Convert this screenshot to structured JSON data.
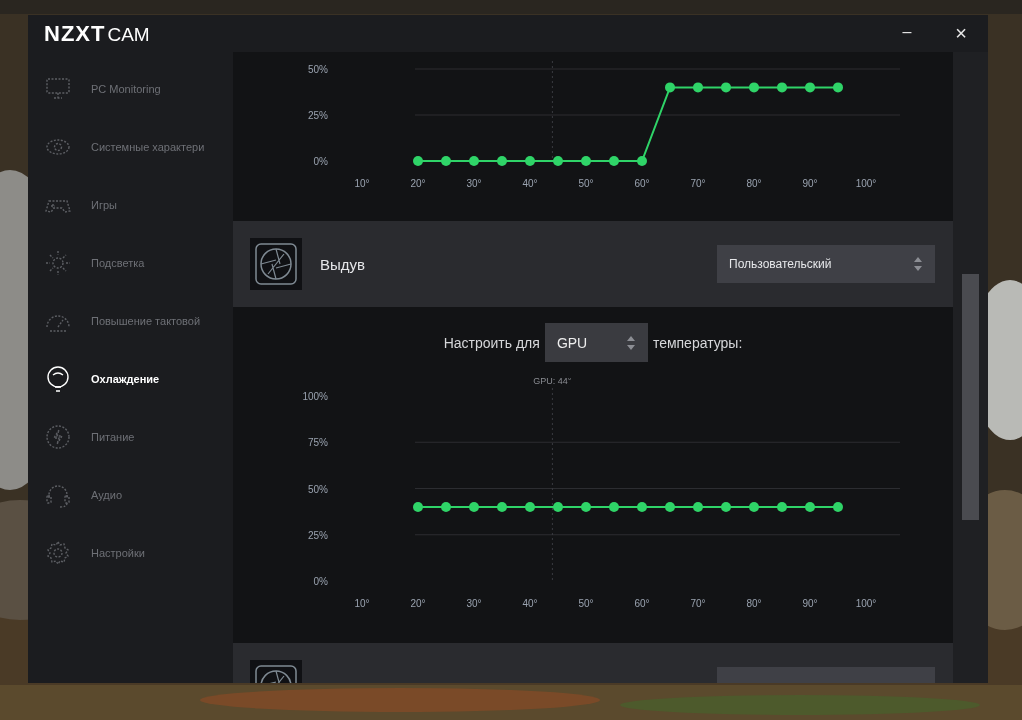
{
  "window": {
    "logo_bold": "NZXT",
    "logo_light": "CAM",
    "controls": [
      {
        "kind": "minimize",
        "label": "–"
      },
      {
        "kind": "close",
        "label": "×"
      }
    ]
  },
  "sidebar": {
    "items": [
      {
        "label": "PC Monitoring",
        "kind": "monitor",
        "selected": false
      },
      {
        "label": "Системные характери",
        "kind": "eye",
        "selected": false
      },
      {
        "label": "Игры",
        "kind": "gamepad",
        "selected": false
      },
      {
        "label": "Подсветка",
        "kind": "sun",
        "selected": false
      },
      {
        "label": "Повышение тактовой",
        "kind": "gauge",
        "selected": false
      },
      {
        "label": "Охлаждение",
        "kind": "bulb",
        "selected": true
      },
      {
        "label": "Питание",
        "kind": "bolt",
        "selected": false
      },
      {
        "label": "Аудио",
        "kind": "headset",
        "selected": false
      },
      {
        "label": "Настройки",
        "kind": "gear",
        "selected": false
      }
    ]
  },
  "sections": [
    {
      "kind": "chart",
      "chart_data": {
        "type": "line",
        "x": [
          20,
          25,
          30,
          35,
          40,
          45,
          50,
          55,
          60,
          65,
          70,
          75,
          80,
          85,
          90,
          95
        ],
        "series": [
          {
            "color": "#2fd468",
            "marker": "circle",
            "values": [
              0,
              0,
              0,
              0,
              0,
              0,
              0,
              0,
              0,
              40,
              40,
              40,
              40,
              40,
              40,
              40
            ]
          }
        ],
        "grid": true,
        "ref_lines": [
          {
            "axis": "x",
            "value": 44
          }
        ],
        "xlim": [
          10,
          100
        ],
        "ylim": [
          0,
          50
        ],
        "xticks": [
          {
            "value": 10,
            "label": "10°"
          },
          {
            "value": 20,
            "label": "20°"
          },
          {
            "value": 30,
            "label": "30°"
          },
          {
            "value": 40,
            "label": "40°"
          },
          {
            "value": 50,
            "label": "50°"
          },
          {
            "value": 60,
            "label": "60°"
          },
          {
            "value": 70,
            "label": "70°"
          },
          {
            "value": 80,
            "label": "80°"
          },
          {
            "value": 90,
            "label": "90°"
          },
          {
            "value": 100,
            "label": "100°"
          }
        ],
        "yticks": [
          {
            "value": 0,
            "label": "0%"
          },
          {
            "value": 25,
            "label": "25%"
          },
          {
            "value": 50,
            "label": "50%"
          }
        ]
      }
    },
    {
      "kind": "fan_header",
      "name": "Выдув",
      "mode": "Пользовательский"
    },
    {
      "kind": "fan_curve",
      "prefix": "Настроить для",
      "source": "GPU",
      "suffix": "температуры:",
      "chart_data": {
        "type": "line",
        "x": [
          20,
          25,
          30,
          35,
          40,
          45,
          50,
          55,
          60,
          65,
          70,
          75,
          80,
          85,
          90,
          95
        ],
        "series": [
          {
            "color": "#2fd468",
            "marker": "circle",
            "values": [
              40,
              40,
              40,
              40,
              40,
              40,
              40,
              40,
              40,
              40,
              40,
              40,
              40,
              40,
              40,
              40
            ]
          }
        ],
        "grid": true,
        "ref_lines": [
          {
            "axis": "x",
            "value": 44
          }
        ],
        "xlim": [
          10,
          100
        ],
        "ylim": [
          0,
          100
        ],
        "xticks": [
          {
            "value": 10,
            "label": "10°"
          },
          {
            "value": 20,
            "label": "20°"
          },
          {
            "value": 30,
            "label": "30°"
          },
          {
            "value": 40,
            "label": "40°"
          },
          {
            "value": 50,
            "label": "50°"
          },
          {
            "value": 60,
            "label": "60°"
          },
          {
            "value": 70,
            "label": "70°"
          },
          {
            "value": 80,
            "label": "80°"
          },
          {
            "value": 90,
            "label": "90°"
          },
          {
            "value": 100,
            "label": "100°"
          }
        ],
        "yticks": [
          {
            "value": 0,
            "label": "0%"
          },
          {
            "value": 25,
            "label": "25%"
          },
          {
            "value": 50,
            "label": "50%"
          },
          {
            "value": 75,
            "label": "75%"
          },
          {
            "value": 100,
            "label": "100%"
          }
        ],
        "annotations": [
          "GPU: 44°"
        ]
      }
    },
    {
      "kind": "fan_header"
    }
  ]
}
